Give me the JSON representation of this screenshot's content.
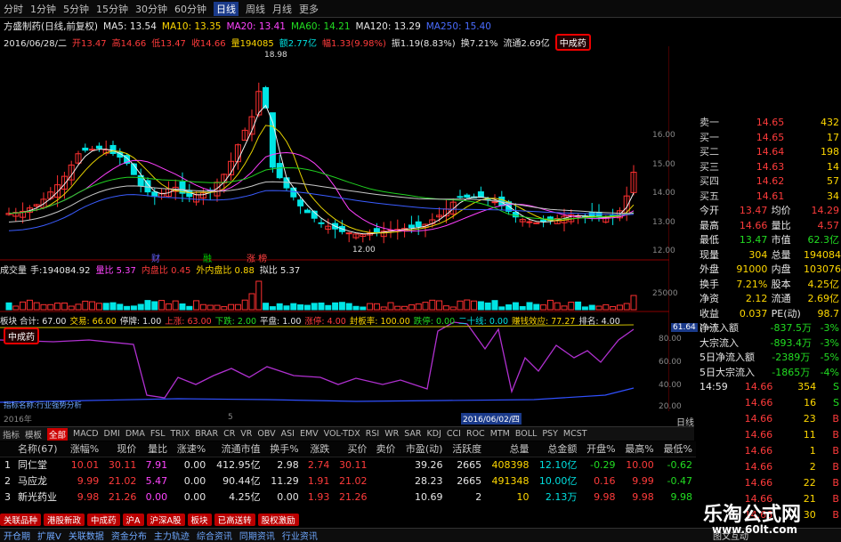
{
  "toolbar": {
    "items": [
      "分时",
      "1分钟",
      "5分钟",
      "15分钟",
      "30分钟",
      "60分钟",
      "日线",
      "周线",
      "月线",
      "更多"
    ],
    "active": "日线"
  },
  "info_line1": {
    "stock": "方盛制药(日线,前复权)",
    "ma5": "MA5: 13.54",
    "ma10": "MA10: 13.35",
    "ma20": "MA20: 13.41",
    "ma60": "MA60: 14.21",
    "ma120": "MA120: 13.29",
    "ma250": "MA250: 15.40"
  },
  "info_line2": {
    "date": "2016/06/28/二",
    "open": "开13.47",
    "high": "高14.66",
    "low": "低13.47",
    "close": "收14.66",
    "vol": "量194085",
    "amount": "额2.77亿",
    "change": "幅1.33(9.98%)",
    "amp": "振1.19(8.83%)",
    "turn": "换7.21%",
    "float": "流通2.69亿",
    "tag": "中成药"
  },
  "price_labels": [
    "16.00",
    "15.00",
    "14.00",
    "13.00",
    "12.00"
  ],
  "peak_label": "18.98",
  "low_label": "12.00",
  "event_markers": [
    "财",
    "融",
    "涨 榜"
  ],
  "vol_header": {
    "title": "成交量",
    "hand": "手:194084.92",
    "liangbi": "量比 5.37",
    "neipan": "内盘比 0.45",
    "waipan": "外内盘比 0.88",
    "nibi": "拟比 5.37"
  },
  "vol_labels": [
    "25000"
  ],
  "ind_header": {
    "title": "板块",
    "total": "合计: 67.00",
    "trade": "交易: 66.00",
    "stop": "停牌: 1.00",
    "up": "上涨: 63.00",
    "down": "下跌: 2.00",
    "flat": "平盘: 1.00",
    "limit": "涨停: 4.00",
    "seal": "封板率: 100.00",
    "dieting": "跌停: 0.00",
    "two_ten": "二十线: 0.00",
    "more": "赚钱效应: 77.27",
    "rank": "排名: 4.00"
  },
  "ind_tag": "中成药",
  "ind_labels": [
    "80.00",
    "60.00",
    "40.00",
    "20.00"
  ],
  "ind_right_val": "61.64",
  "ind_footnote": "指标名称:行业强势分析",
  "axis_dates": {
    "left": "2016年",
    "mid": "5",
    "selected": "2016/06/02/四"
  },
  "right_panel": {
    "rows": [
      {
        "lab": "卖一",
        "p": "14.65",
        "v": "432"
      },
      {
        "lab": "买一",
        "p": "14.65",
        "v": "17"
      },
      {
        "lab": "买二",
        "p": "14.64",
        "v": "198"
      },
      {
        "lab": "买三",
        "p": "14.63",
        "v": "14"
      },
      {
        "lab": "买四",
        "p": "14.62",
        "v": "57"
      },
      {
        "lab": "买五",
        "p": "14.61",
        "v": "34"
      }
    ],
    "stats": [
      [
        "今开",
        "13.47",
        "均价",
        "14.29"
      ],
      [
        "最高",
        "14.66",
        "量比",
        "4.57"
      ],
      [
        "最低",
        "13.47",
        "市值",
        "62.3亿"
      ],
      [
        "现量",
        "304",
        "总量",
        "194084"
      ],
      [
        "外盘",
        "91000",
        "内盘",
        "103076"
      ],
      [
        "换手",
        "7.21%",
        "股本",
        "4.25亿"
      ],
      [
        "净资",
        "2.12",
        "流通",
        "2.69亿"
      ],
      [
        "收益(一)",
        "0.037",
        "PE(动)",
        "98.7"
      ]
    ],
    "flows": [
      [
        "净流入额",
        "-837.5万",
        "-3%"
      ],
      [
        "大宗流入",
        "-893.4万",
        "-3%"
      ],
      [
        "5日净流入额",
        "-2389万",
        "-5%"
      ],
      [
        "5日大宗流入",
        "-1865万",
        "-4%"
      ]
    ],
    "ticks": [
      [
        "14:59",
        "14.66",
        "354",
        "S"
      ],
      [
        "",
        "14.66",
        "16",
        "S"
      ],
      [
        "",
        "14.66",
        "23",
        "B"
      ],
      [
        "",
        "14.66",
        "11",
        "B"
      ],
      [
        "",
        "14.66",
        "1",
        "B"
      ],
      [
        "",
        "14.66",
        "2",
        "B"
      ],
      [
        "",
        "14.66",
        "22",
        "B"
      ],
      [
        "",
        "14.66",
        "21",
        "B"
      ],
      [
        "",
        "14.66",
        "30",
        "B"
      ]
    ]
  },
  "right_sidebar_label": "日线",
  "bottom_tabs": [
    "指标",
    "模板",
    "全部",
    "MACD",
    "DMI",
    "DMA",
    "FSL",
    "TRIX",
    "BRAR",
    "CR",
    "VR",
    "OBV",
    "ASI",
    "EMV",
    "VOL-TDX",
    "RSI",
    "WR",
    "SAR",
    "KDJ",
    "CCI",
    "ROC",
    "MTM",
    "BOLL",
    "PSY",
    "MCST"
  ],
  "bottom_tab_active": "全部",
  "table": {
    "headers": [
      "",
      "名称(67)",
      "涨幅%",
      "现价",
      "量比",
      "涨速%",
      "流通市值",
      "换手%",
      "涨跌",
      "买价",
      "卖价",
      "市盈(动)",
      "活跃度",
      "总量",
      "总金额",
      "开盘%",
      "最高%",
      "最低%"
    ],
    "rows": [
      [
        "1",
        "同仁堂",
        "10.01",
        "30.11",
        "7.91",
        "0.00",
        "412.95亿",
        "2.98",
        "2.74",
        "30.11",
        "",
        "39.26",
        "2665",
        "408398",
        "12.10亿",
        "-0.29",
        "10.00",
        "-0.62"
      ],
      [
        "2",
        "马应龙",
        "9.99",
        "21.02",
        "5.47",
        "0.00",
        "90.44亿",
        "11.29",
        "1.91",
        "21.02",
        "",
        "28.23",
        "2665",
        "491348",
        "10.00亿",
        "0.16",
        "9.99",
        "-0.47"
      ],
      [
        "3",
        "新光药业",
        "9.98",
        "21.26",
        "0.00",
        "0.00",
        "4.25亿",
        "0.00",
        "1.93",
        "21.26",
        "",
        "10.69",
        "2",
        "10",
        "2.13万",
        "9.98",
        "9.98",
        "9.98"
      ]
    ]
  },
  "sector_tabs": [
    "关联品种",
    "港股新政",
    "中成药",
    "沪A",
    "沪深A股",
    "板块",
    "已高送转",
    "股权激励"
  ],
  "status_items": [
    "开仓期",
    "扩展V",
    "关联数据",
    "资金分布",
    "主力轨迹",
    "综合资讯",
    "同期资讯",
    "行业资讯"
  ],
  "status_right": "图文互动",
  "watermark": "乐淘公式网",
  "watermark2": "www.60lt.com"
}
